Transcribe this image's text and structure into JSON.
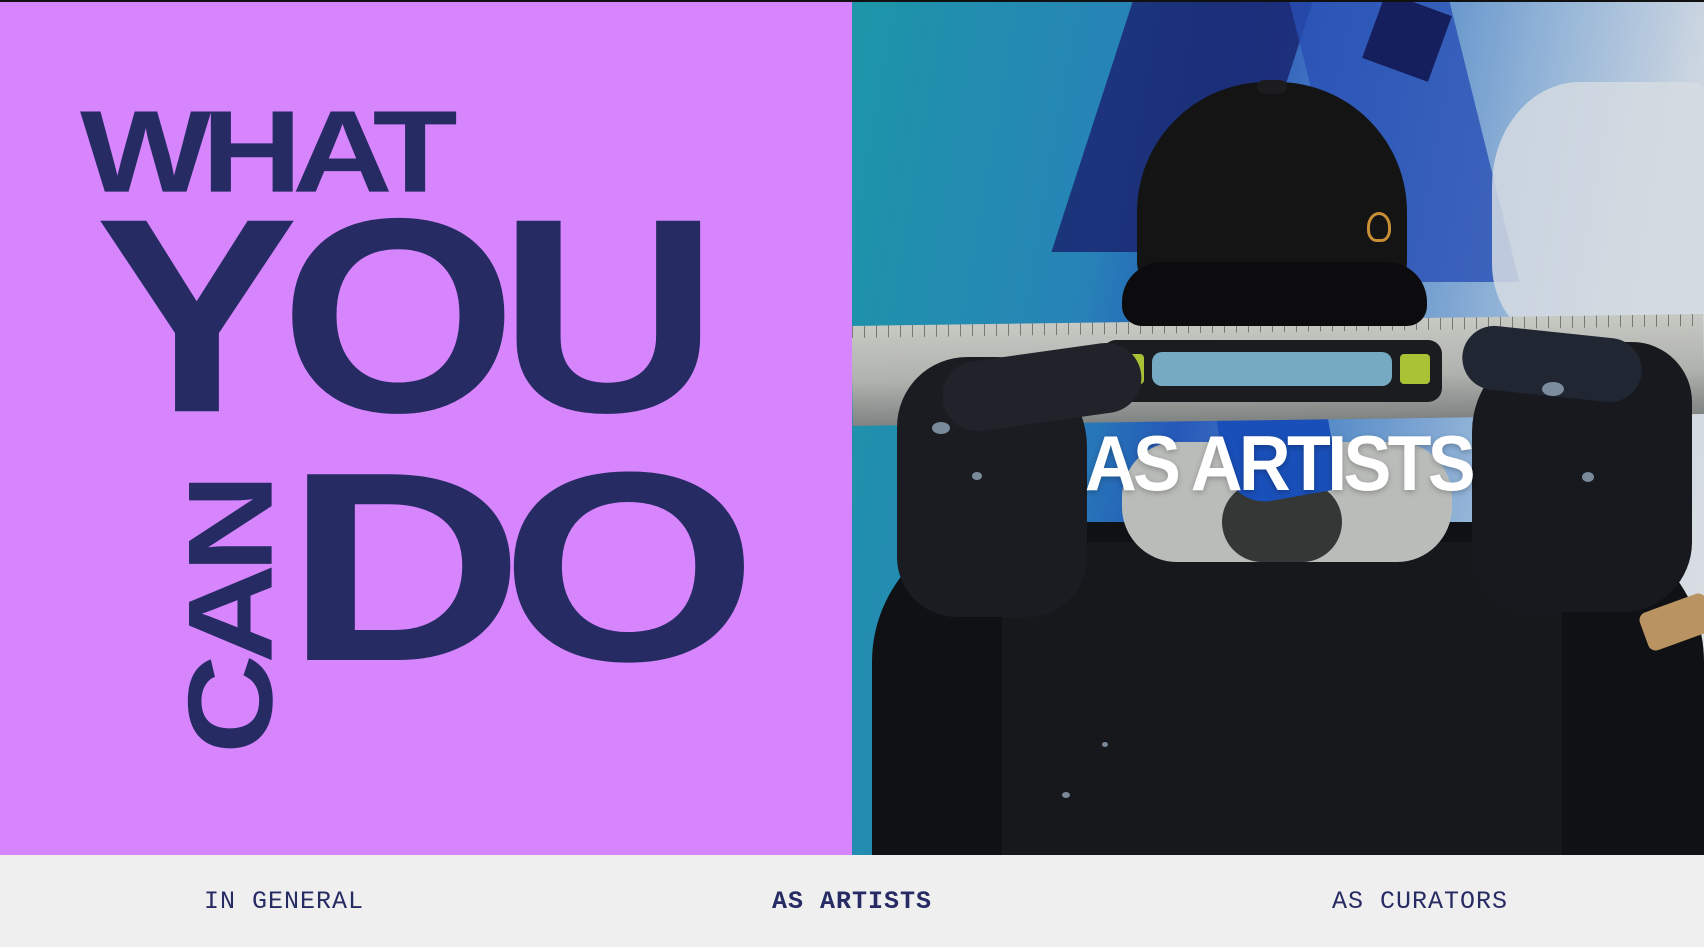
{
  "headline": {
    "what": "WHAT",
    "you": "YOU",
    "can": "CAN",
    "do": "DO",
    "color": "#272b63",
    "background": "#d685fd"
  },
  "hero": {
    "overlay_title": "AS ARTISTS"
  },
  "tabs": [
    {
      "label": "IN GENERAL",
      "active": false
    },
    {
      "label": "AS ARTISTS",
      "active": true
    },
    {
      "label": "AS CURATORS",
      "active": false
    }
  ]
}
